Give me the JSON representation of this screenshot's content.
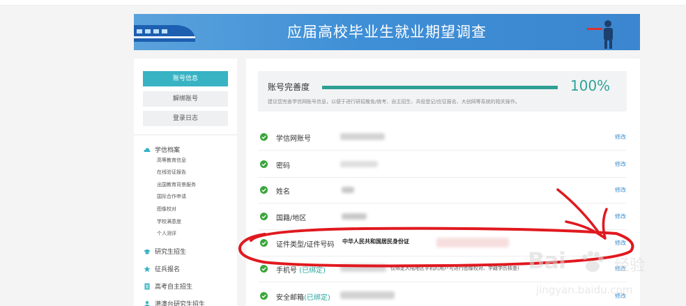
{
  "banner": {
    "title": "应届高校毕业生就业期望调查"
  },
  "sidebar": {
    "buttons": [
      {
        "label": "账号信息",
        "active": true
      },
      {
        "label": "解绑账号",
        "active": false
      },
      {
        "label": "登录日志",
        "active": false
      }
    ],
    "archive": {
      "title": "学信档案",
      "items": [
        "高等教育信息",
        "在线验证报告",
        "出国教育背景服务",
        "国际合作申请",
        "图像校对",
        "学校满意度",
        "个人测评"
      ]
    },
    "groups": [
      "研究生招生",
      "征兵报名",
      "高考自主招生",
      "港澳台研究生招生"
    ]
  },
  "completeness": {
    "label": "账号完善度",
    "percent_text": "100%",
    "progress": 1.0,
    "hint": "建议您完善学信网账号信息，以便于进行研招推免/统考、自主招生、兵役登记/应征报名、大创网等系统的相关操作。"
  },
  "rows": [
    {
      "label": "学信网账号",
      "bound": "",
      "value": "",
      "note": "",
      "edit": "修改"
    },
    {
      "label": "密码",
      "bound": "",
      "value": "",
      "note": "",
      "edit": "修改"
    },
    {
      "label": "姓名",
      "bound": "",
      "value": "",
      "note": "",
      "edit": "修改"
    },
    {
      "label": "国籍/地区",
      "bound": "",
      "value": "",
      "note": "",
      "edit": "修改"
    },
    {
      "label": "证件类型/证件号码",
      "bound": "",
      "value": "中华人民共和国居民身份证",
      "note": "",
      "edit": "修改"
    },
    {
      "label": "手机号",
      "bound": "(已绑定)",
      "value": "",
      "note": "仅绑定大陆地区手机的用户可进行图像校对、学籍学历核查)",
      "edit": "修改"
    },
    {
      "label": "安全邮箱",
      "bound": "(已绑定)",
      "value": "",
      "note": "",
      "edit": "修改"
    }
  ],
  "watermark": {
    "logo": "Bai",
    "logo_tail": "经验",
    "url": "jingyan.baidu.com"
  },
  "colors": {
    "accent": "#37b3c4",
    "progress": "#2f9f95",
    "link": "#3a8fd0",
    "check": "#3aa53a",
    "annotation": "#e0191f"
  }
}
